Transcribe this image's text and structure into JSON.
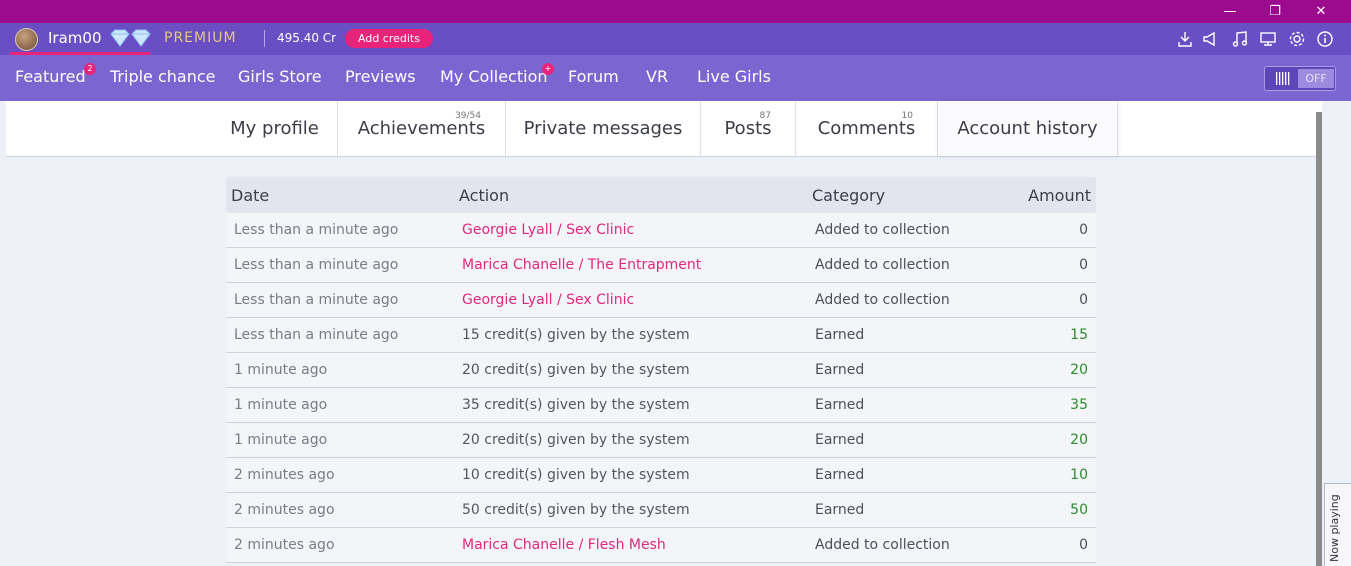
{
  "window": {
    "minimize_glyph": "—",
    "restore_glyph": "❐",
    "close_glyph": "✕"
  },
  "account": {
    "username": "Iram00",
    "tier": "PREMIUM",
    "credits": "495.40 Cr",
    "add_credits_label": "Add credits",
    "icons": [
      "download-icon",
      "megaphone-icon",
      "music-icon",
      "display-icon",
      "settings-icon",
      "info-icon"
    ]
  },
  "nav": {
    "items": [
      {
        "label": "Featured",
        "badge": "2"
      },
      {
        "label": "Triple chance"
      },
      {
        "label": "Girls Store"
      },
      {
        "label": "Previews"
      },
      {
        "label": "My Collection",
        "badge": "+"
      },
      {
        "label": "Forum"
      },
      {
        "label": "VR"
      },
      {
        "label": "Live Girls"
      }
    ],
    "toggle_label": "OFF"
  },
  "tabs": [
    {
      "label": "My profile"
    },
    {
      "label": "Achievements",
      "count": "39/54"
    },
    {
      "label": "Private messages"
    },
    {
      "label": "Posts",
      "count": "87"
    },
    {
      "label": "Comments",
      "count": "10"
    },
    {
      "label": "Account history",
      "active": true
    }
  ],
  "history": {
    "columns": {
      "date": "Date",
      "action": "Action",
      "category": "Category",
      "amount": "Amount"
    },
    "rows": [
      {
        "date": "Less than a minute ago",
        "action": "Georgie Lyall / Sex Clinic",
        "category": "Added to collection",
        "amount": "0"
      },
      {
        "date": "Less than a minute ago",
        "action": "Marica Chanelle / The Entrapment",
        "category": "Added to collection",
        "amount": "0"
      },
      {
        "date": "Less than a minute ago",
        "action": "Georgie Lyall / Sex Clinic",
        "category": "Added to collection",
        "amount": "0"
      },
      {
        "date": "Less than a minute ago",
        "action": "15 credit(s) given by the system",
        "category": "Earned",
        "amount": "15"
      },
      {
        "date": "1 minute ago",
        "action": "20 credit(s) given by the system",
        "category": "Earned",
        "amount": "20"
      },
      {
        "date": "1 minute ago",
        "action": "35 credit(s) given by the system",
        "category": "Earned",
        "amount": "35"
      },
      {
        "date": "1 minute ago",
        "action": "20 credit(s) given by the system",
        "category": "Earned",
        "amount": "20"
      },
      {
        "date": "2 minutes ago",
        "action": "10 credit(s) given by the system",
        "category": "Earned",
        "amount": "10"
      },
      {
        "date": "2 minutes ago",
        "action": "50 credit(s) given by the system",
        "category": "Earned",
        "amount": "50"
      },
      {
        "date": "2 minutes ago",
        "action": "Marica Chanelle / Flesh Mesh",
        "category": "Added to collection",
        "amount": "0"
      }
    ]
  },
  "now_playing_label": "Now playing",
  "colors": {
    "titlebar": "#9c0b8e",
    "accountbar": "#6a4fc4",
    "navbar": "#7b65d0",
    "accent": "#e8247a",
    "link": "#e0287f",
    "earned": "#2e8a2e"
  }
}
